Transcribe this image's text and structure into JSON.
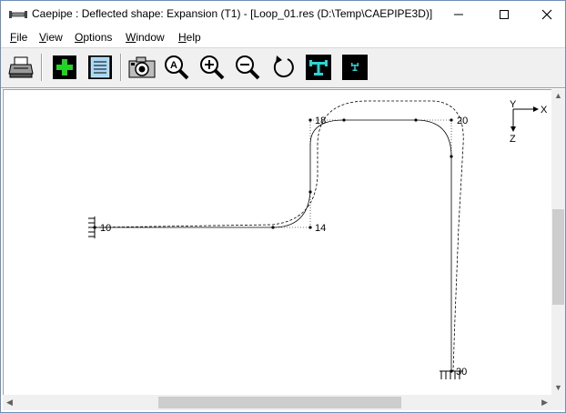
{
  "window": {
    "title": "Caepipe : Deflected shape: Expansion (T1) -  [Loop_01.res (D:\\Temp\\CAEPIPE3D)]",
    "controls": [
      "minimize",
      "maximize",
      "close"
    ]
  },
  "menu": [
    {
      "key": "F",
      "rest": "ile"
    },
    {
      "key": "V",
      "rest": "iew"
    },
    {
      "key": "O",
      "rest": "ptions"
    },
    {
      "key": "W",
      "rest": "indow"
    },
    {
      "key": "H",
      "rest": "elp"
    }
  ],
  "toolbar": {
    "icons": [
      "printer-icon",
      "add-icon",
      "list-icon",
      "camera-icon",
      "zoom-fit-icon",
      "zoom-in-icon",
      "zoom-out-icon",
      "rotate-icon",
      "pipe-view-icon",
      "pipe-small-icon"
    ],
    "zoom_fit_letter": "A"
  },
  "canvas": {
    "axes": {
      "x": "X",
      "y": "Y",
      "z": "Z"
    },
    "nodes": [
      {
        "id": "n10",
        "label": "10",
        "color": "#a0a0a0"
      },
      {
        "id": "n14",
        "label": "14",
        "color": "#000000"
      },
      {
        "id": "n18",
        "label": "18",
        "color": "#000000"
      },
      {
        "id": "n20",
        "label": "20",
        "color": "#000000"
      },
      {
        "id": "n30",
        "label": "30",
        "color": "#000000"
      }
    ],
    "colors": {
      "pipe": "#000000",
      "deflected": "#000000",
      "background": "#ffffff"
    }
  },
  "scrollbars": {
    "vertical_thumb_fraction_start": 0.38,
    "vertical_thumb_fraction_size": 0.35,
    "horizontal_thumb_fraction_start": 0.27,
    "horizontal_thumb_fraction_size": 0.47
  }
}
